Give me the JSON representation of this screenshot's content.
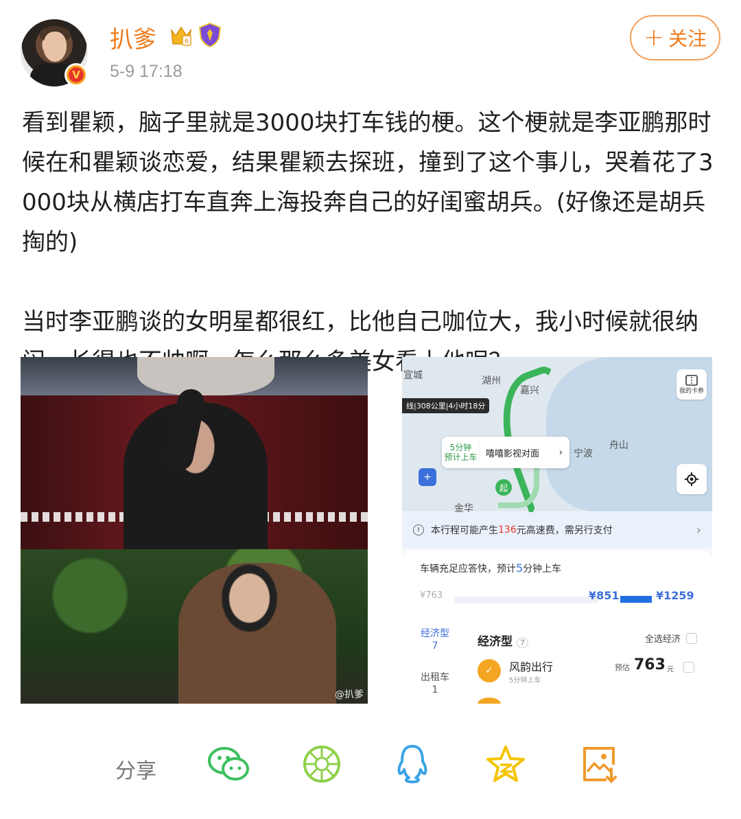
{
  "author": {
    "name": "扒爹",
    "timestamp": "5-9 17:18",
    "verified_badge": "V",
    "crown_badge_number": "6"
  },
  "follow_button": {
    "label": "关注"
  },
  "post": {
    "paragraph1": "看到瞿颖，脑子里就是3000块打车钱的梗。这个梗就是李亚鹏那时候在和瞿颖谈恋爱，结果瞿颖去探班，撞到了这个事儿，哭着花了3000块从横店打车直奔上海投奔自己的好闺蜜胡兵。(好像还是胡兵掏的)",
    "paragraph2": "当时李亚鹏谈的女明星都很红，比他自己咖位大，我小时候就很纳闷，长得也不帅啊，怎么那么多美女看上他呢？"
  },
  "image_left": {
    "watermark": "@扒爹"
  },
  "image_right": {
    "map_labels": {
      "city1": "宣城",
      "city2": "湖州",
      "city3": "嘉兴",
      "city4": "宁波",
      "city5": "舟山",
      "city6": "金华"
    },
    "route_chip": "线|308公里|4小时18分",
    "destination": {
      "eta_line1": "5分钟",
      "eta_line2": "预计上车",
      "name": "嘻嘻影视对面",
      "chevron": "›"
    },
    "card_button": "我的卡券",
    "start_pin": "起",
    "toll_notice": {
      "prefix": "本行程可能产生",
      "amount": "136",
      "suffix": "元高速费，需另行支付",
      "chevron": "›"
    },
    "quick_text": {
      "prefix": "车辆充足应答快，预计",
      "minutes": "5",
      "suffix": "分钟上车"
    },
    "prices": {
      "low": "¥763",
      "mid": "¥851",
      "high": "¥1259"
    },
    "side_tabs": [
      {
        "label": "经济型",
        "count": "7"
      },
      {
        "label": "出租车",
        "count": "1"
      }
    ],
    "category": {
      "title": "经济型",
      "count": "7",
      "select_all": "全选经济"
    },
    "ride": {
      "name": "风韵出行",
      "sub": "5分钟上车",
      "est_label": "预估",
      "price": "763",
      "unit": "元"
    }
  },
  "share": {
    "label": "分享",
    "icons": [
      "wechat-icon",
      "moments-icon",
      "qq-icon",
      "qzone-icon",
      "save-image-icon"
    ],
    "colors": {
      "wechat": "#3cbf5e",
      "moments": "#8ed14a",
      "qq": "#3aa3e6",
      "qzone": "#f5c400",
      "save": "#f09a2b"
    }
  }
}
